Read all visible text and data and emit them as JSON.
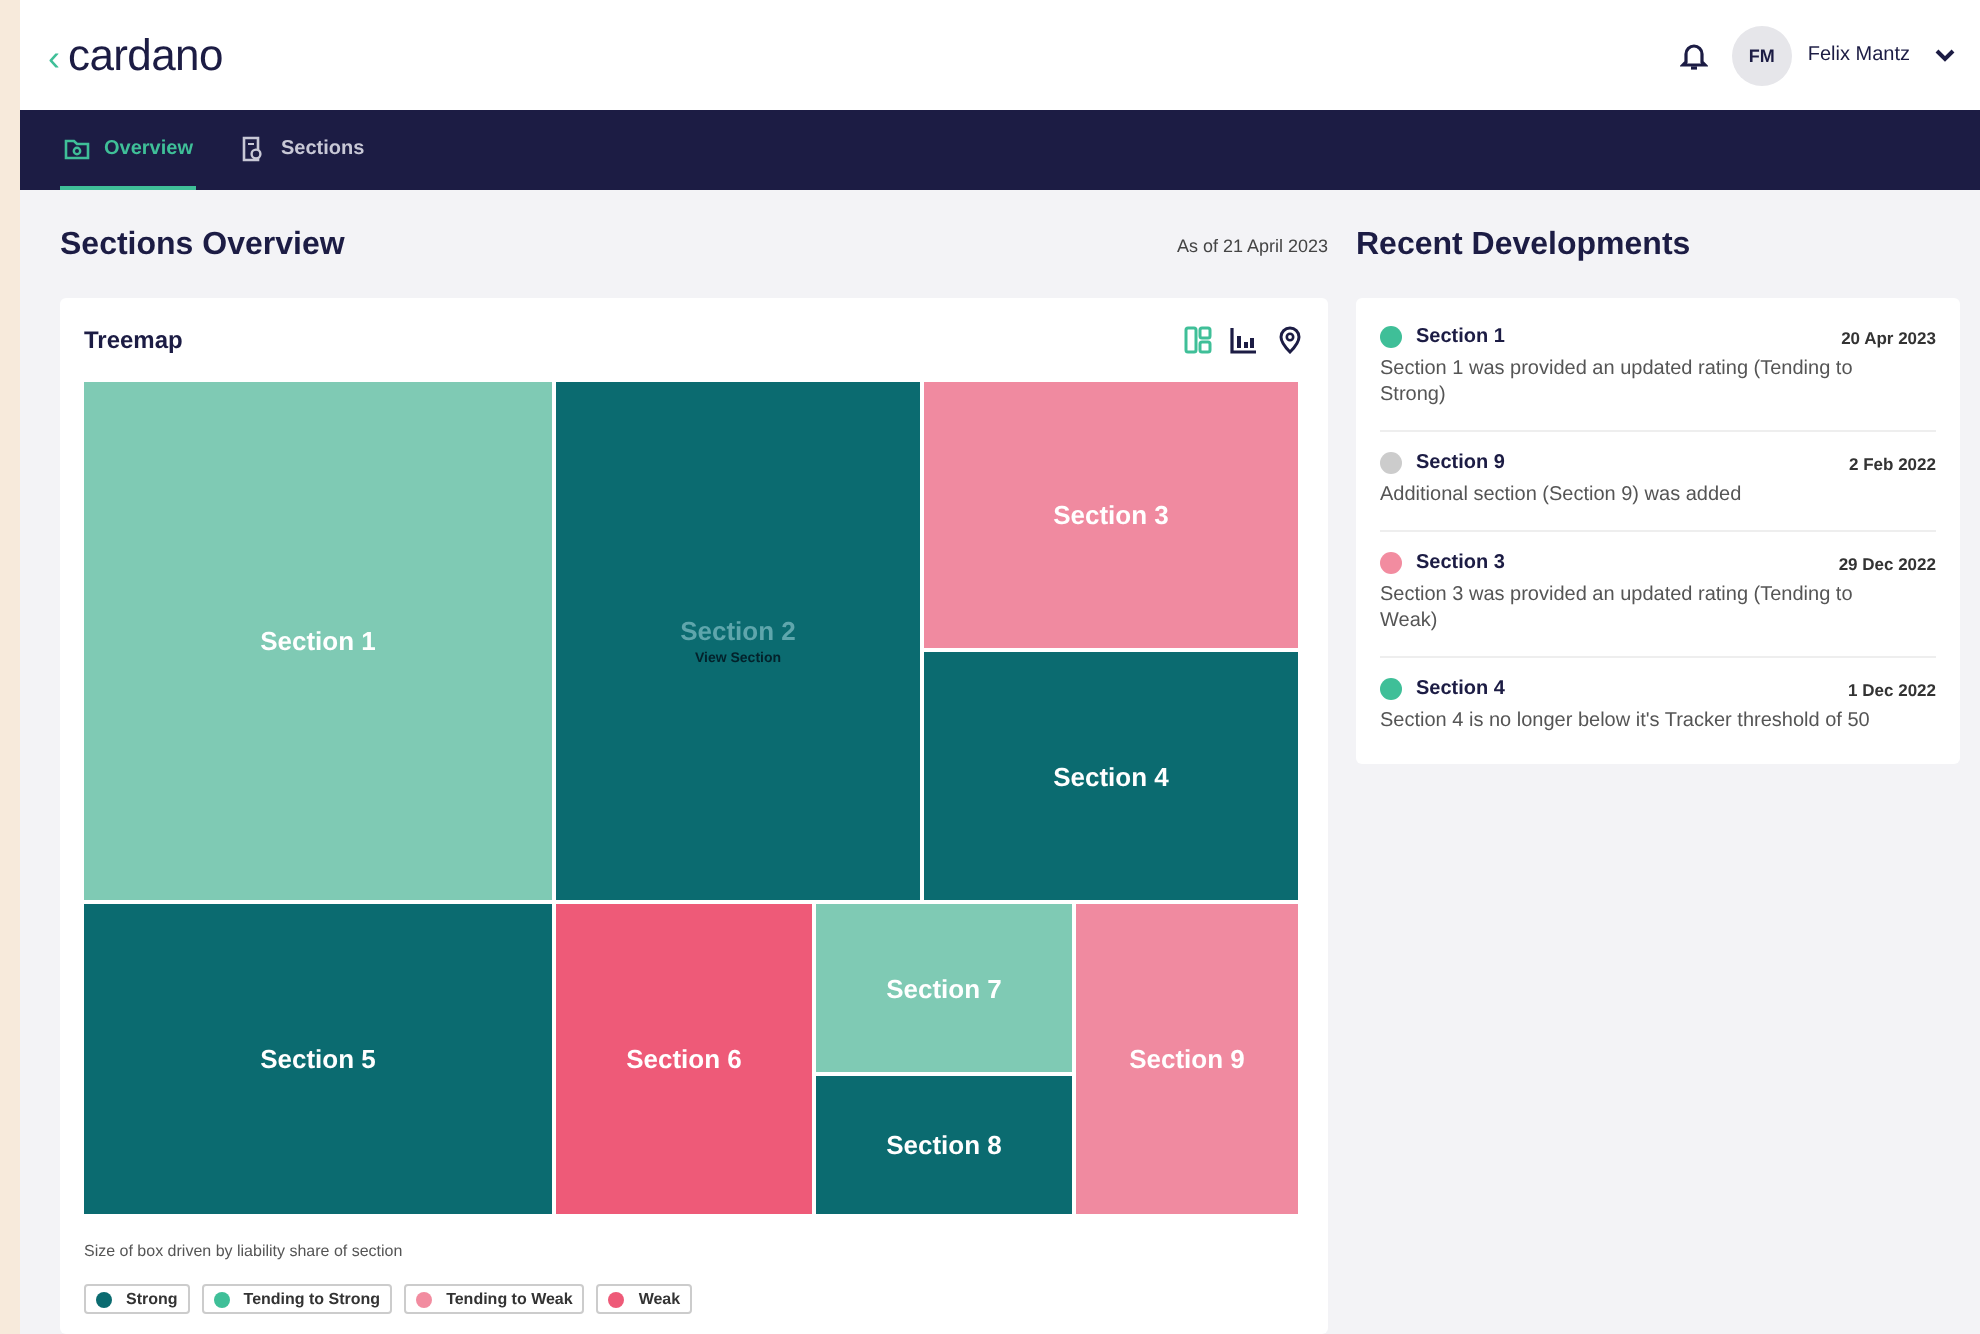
{
  "header": {
    "back": "‹",
    "logo": "cardano",
    "user": {
      "initials": "FM",
      "name": "Felix Mantz"
    }
  },
  "tabs": [
    {
      "label": "Overview",
      "selected": true
    },
    {
      "label": "Sections",
      "selected": false
    }
  ],
  "overview": {
    "title": "Sections Overview",
    "as_of": "As of 21 April 2023"
  },
  "treemap_card": {
    "title": "Treemap",
    "views": [
      {
        "kind": "treemap",
        "selected": true
      },
      {
        "kind": "bar",
        "selected": false
      },
      {
        "kind": "map",
        "selected": false
      }
    ],
    "tiles": [
      {
        "label": "Section 1",
        "color": "#7fcab4",
        "hovered": false
      },
      {
        "label": "Section 2",
        "color": "#0b6b70",
        "hovered": true,
        "action": "View Section"
      },
      {
        "label": "Section 3",
        "color": "#f08aa0",
        "hovered": false
      },
      {
        "label": "Section 4",
        "color": "#0b6b70",
        "hovered": false
      },
      {
        "label": "Section 5",
        "color": "#0b6b70",
        "hovered": false
      },
      {
        "label": "Section 6",
        "color": "#ee5a78",
        "hovered": false
      },
      {
        "label": "Section 7",
        "color": "#7fcab4",
        "hovered": false
      },
      {
        "label": "Section 8",
        "color": "#0b6b70",
        "hovered": false
      },
      {
        "label": "Section 9",
        "color": "#f08aa0",
        "hovered": false
      }
    ],
    "note": "Size of box driven by liability share of section",
    "legend": [
      {
        "label": "Strong",
        "color": "#0b6b70"
      },
      {
        "label": "Tending to Strong",
        "color": "#3fbf98"
      },
      {
        "label": "Tending to Weak",
        "color": "#f28ca0"
      },
      {
        "label": "Weak",
        "color": "#ee5a78"
      }
    ]
  },
  "recent": {
    "title": "Recent Developments",
    "events": [
      {
        "section": "Section 1",
        "date": "20 Apr 2023",
        "text": "Section 1 was provided an updated rating (Tending to Strong)",
        "color": "#3fbf98"
      },
      {
        "section": "Section 9",
        "date": "2 Feb 2022",
        "text": "Additional section (Section 9) was added",
        "color": "#cccccc"
      },
      {
        "section": "Section 3",
        "date": "29 Dec 2022",
        "text": "Section 3 was provided an updated rating (Tending to Weak)",
        "color": "#f28ca0"
      },
      {
        "section": "Section 4",
        "date": "1 Dec 2022",
        "text": "Section 4 is no longer below it's Tracker threshold of 50",
        "color": "#3fbf98"
      }
    ]
  }
}
